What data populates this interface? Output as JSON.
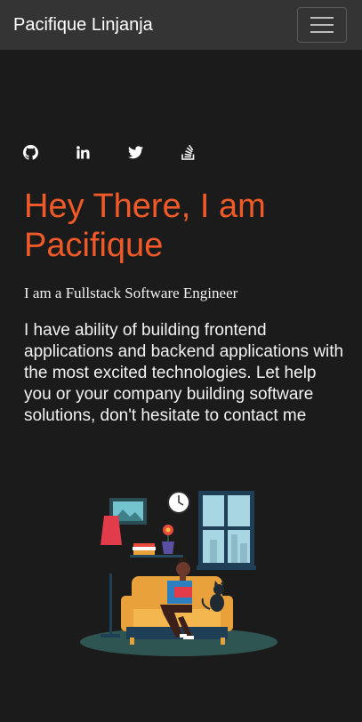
{
  "navbar": {
    "brand": "Pacifique Linjanja",
    "toggle_icon": "hamburger-menu-icon"
  },
  "socials": [
    {
      "name": "github",
      "icon": "github-icon"
    },
    {
      "name": "linkedin",
      "icon": "linkedin-icon"
    },
    {
      "name": "twitter",
      "icon": "twitter-icon"
    },
    {
      "name": "stackoverflow",
      "icon": "stackoverflow-icon"
    }
  ],
  "hero": {
    "headline": "Hey There, I am Pacifique",
    "subtitle": "I am a Fullstack Software Engineer",
    "description": "I have ability of building frontend applications and backend applications with the most excited technologies. Let help you or your company building software solutions, don't hesitate to contact me"
  },
  "colors": {
    "background": "#1c1b1b",
    "navbar": "#343434",
    "accent": "#f05a28",
    "text": "#f2f2f2"
  }
}
